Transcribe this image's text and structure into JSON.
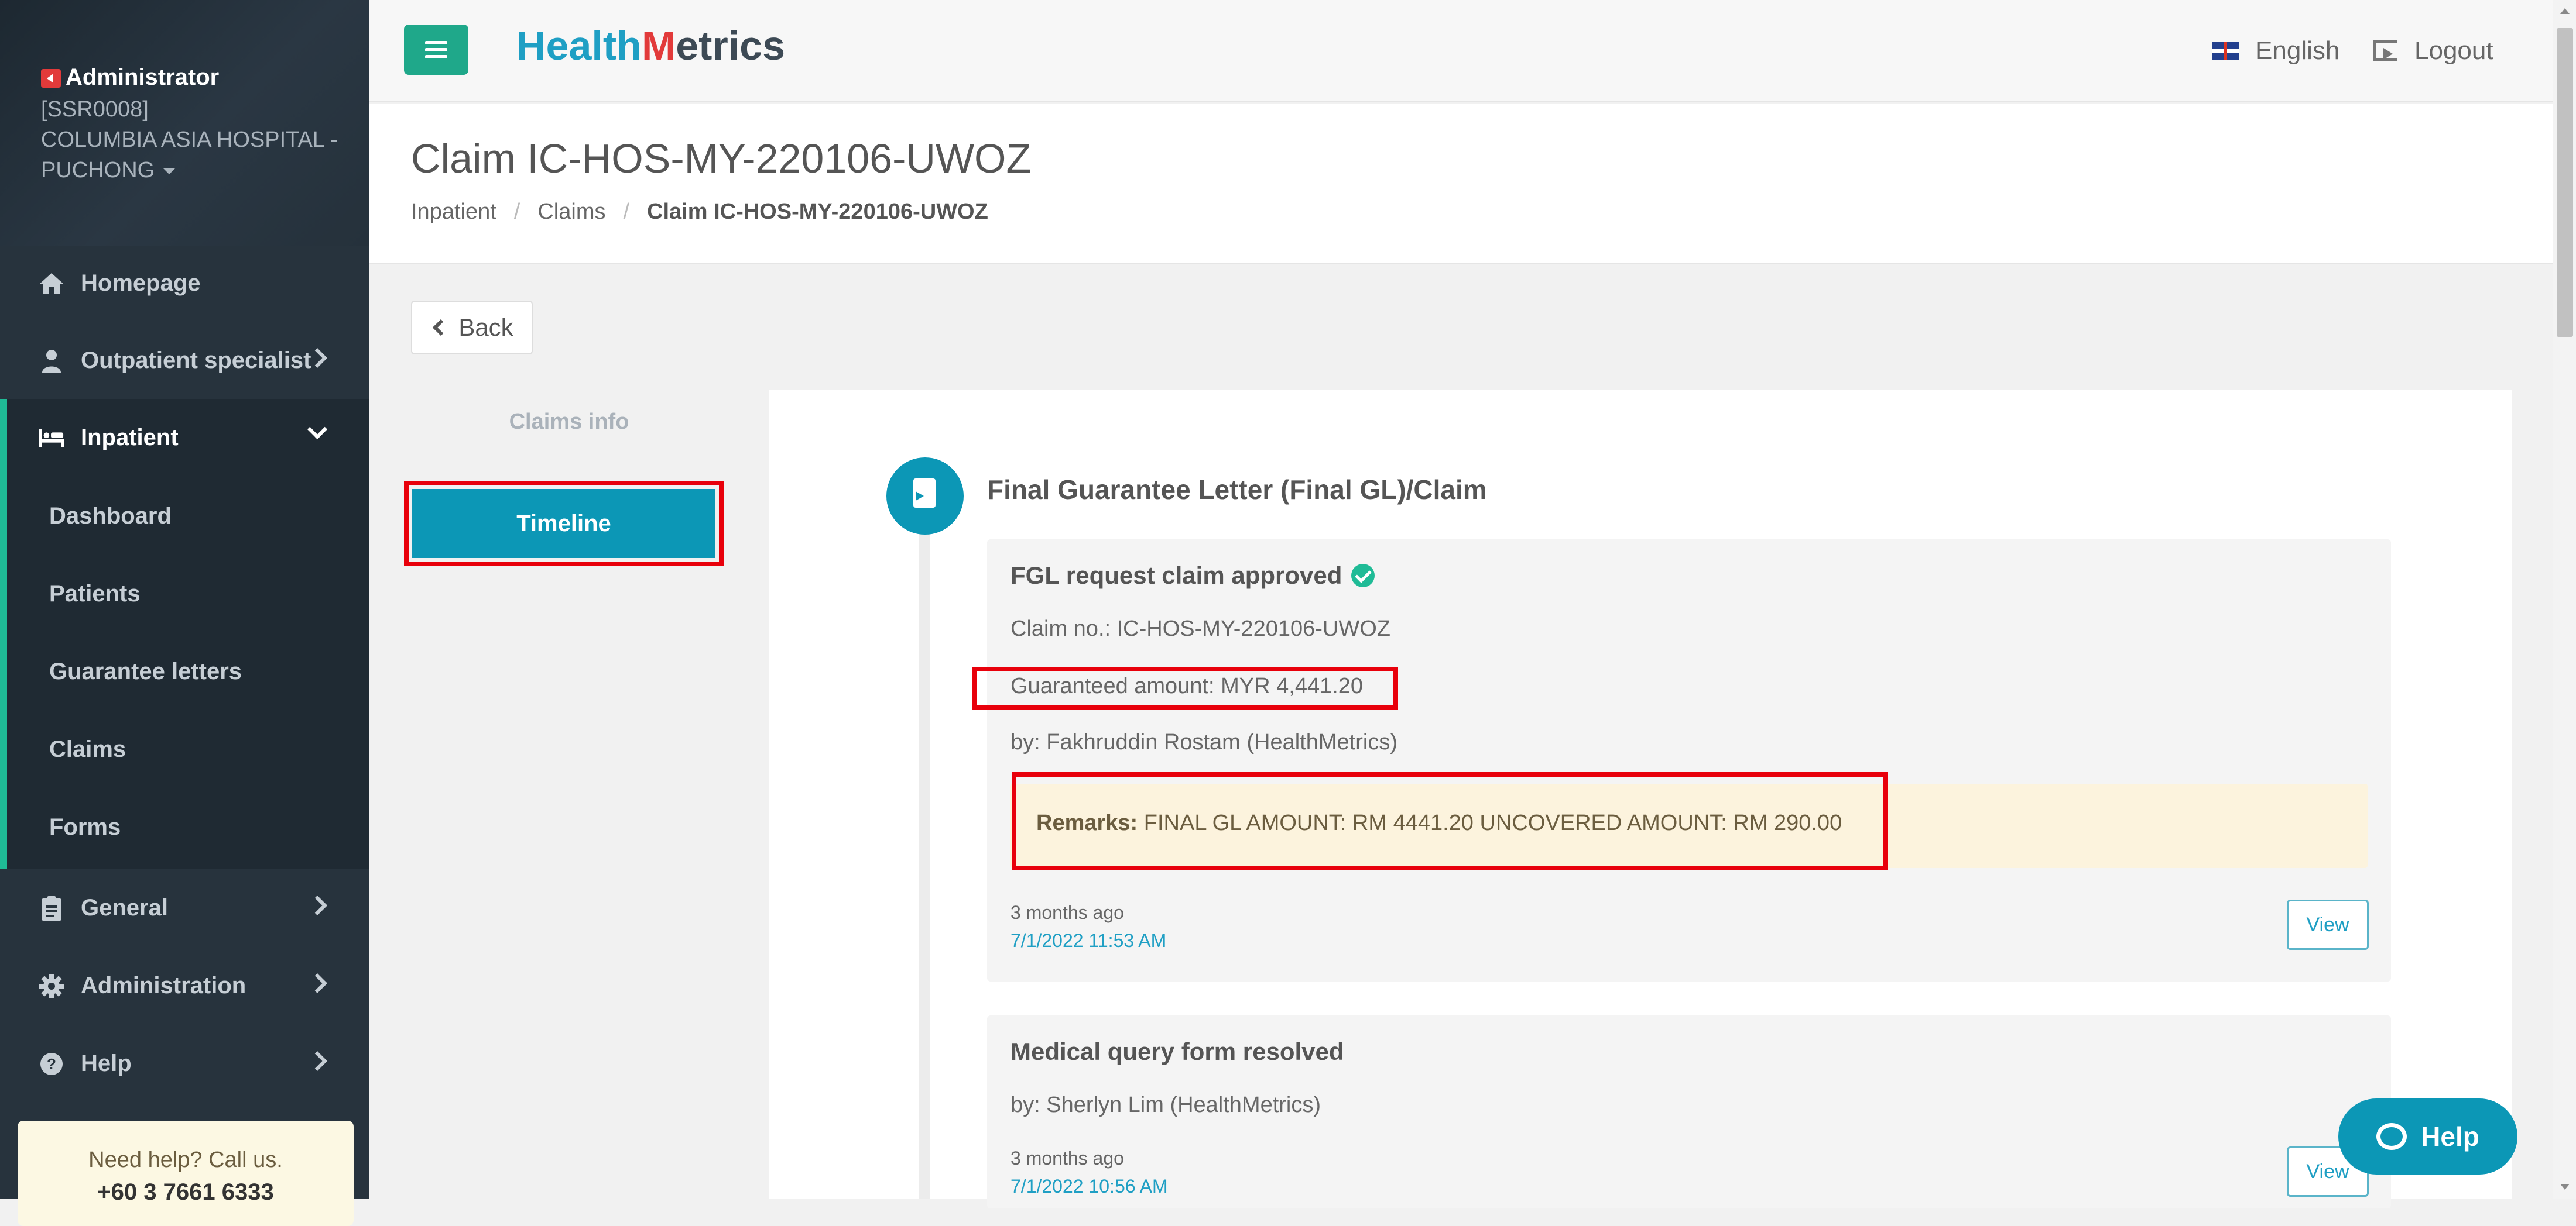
{
  "sidebar": {
    "profile": {
      "role": "Administrator",
      "code": "[SSR0008]",
      "org_line1": "COLUMBIA ASIA HOSPITAL -",
      "org_line2": "PUCHONG"
    },
    "items": [
      {
        "label": "Homepage",
        "icon": "home-icon"
      },
      {
        "label": "Outpatient specialist",
        "icon": "user-doctor-icon"
      },
      {
        "label": "Inpatient",
        "icon": "bed-icon"
      },
      {
        "label": "General",
        "icon": "clipboard-icon"
      },
      {
        "label": "Administration",
        "icon": "gear-icon"
      },
      {
        "label": "Help",
        "icon": "question-circle-icon"
      }
    ],
    "inpatient_sub": [
      "Dashboard",
      "Patients",
      "Guarantee letters",
      "Claims",
      "Forms"
    ],
    "help_call": {
      "text": "Need help? Call us.",
      "phone": "+60 3 7661 6333"
    }
  },
  "topbar": {
    "logo_part1": "Health",
    "logo_part2": "M",
    "logo_part3": "etrics",
    "language": "English",
    "logout": "Logout"
  },
  "page": {
    "title": "Claim IC-HOS-MY-220106-UWOZ",
    "breadcrumb": [
      "Inpatient",
      "Claims",
      "Claim IC-HOS-MY-220106-UWOZ"
    ],
    "back_label": "Back",
    "tabs": [
      "Claims info",
      "Timeline"
    ]
  },
  "timeline": {
    "section_title": "Final Guarantee Letter (Final GL)/Claim",
    "entries": [
      {
        "title": "FGL request claim approved",
        "claim_no": "Claim no.: IC-HOS-MY-220106-UWOZ",
        "amount": "Guaranteed amount: MYR 4,441.20",
        "by": "by: Fakhruddin Rostam (HealthMetrics)",
        "remarks_label": "Remarks:",
        "remarks_text": "FINAL GL AMOUNT: RM 4441.20 UNCOVERED AMOUNT: RM 290.00",
        "ago": "3 months ago",
        "timestamp": "7/1/2022 11:53 AM",
        "view": "View"
      },
      {
        "title": "Medical query form resolved",
        "by": "by: Sherlyn Lim (HealthMetrics)",
        "ago": "3 months ago",
        "timestamp": "7/1/2022 10:56 AM",
        "view": "View"
      }
    ]
  },
  "help_fab": "Help",
  "colors": {
    "sidebar": "#27333d",
    "accent_green": "#1fbb96",
    "accent_blue": "#0c97b6",
    "highlight_red": "#e8000b"
  }
}
